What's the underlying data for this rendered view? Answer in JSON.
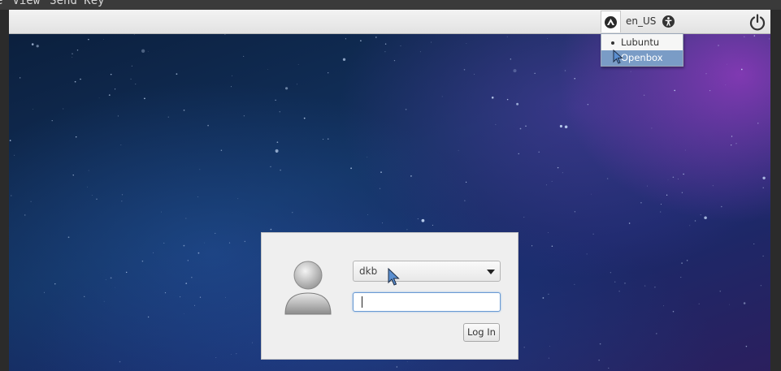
{
  "host_window": {
    "menu": [
      "e",
      "View",
      "Send Key"
    ]
  },
  "top_panel": {
    "session_icon": "lubuntu-logo-icon",
    "language": "en_US",
    "accessibility_icon": "accessibility-icon",
    "power_icon": "power-icon"
  },
  "session_menu": {
    "items": [
      {
        "label": "Lubuntu",
        "selected": true
      },
      {
        "label": "Openbox",
        "highlighted": true
      }
    ]
  },
  "login_dialog": {
    "avatar_icon": "user-avatar-icon",
    "username": "dkb",
    "password_value": "",
    "login_button_label": "Log In"
  },
  "colors": {
    "panel": "#e8e8e8",
    "menu_highlight": "#7a9cc6",
    "focus_border": "#6a9ad4",
    "pointer": "#5b8fd0"
  }
}
